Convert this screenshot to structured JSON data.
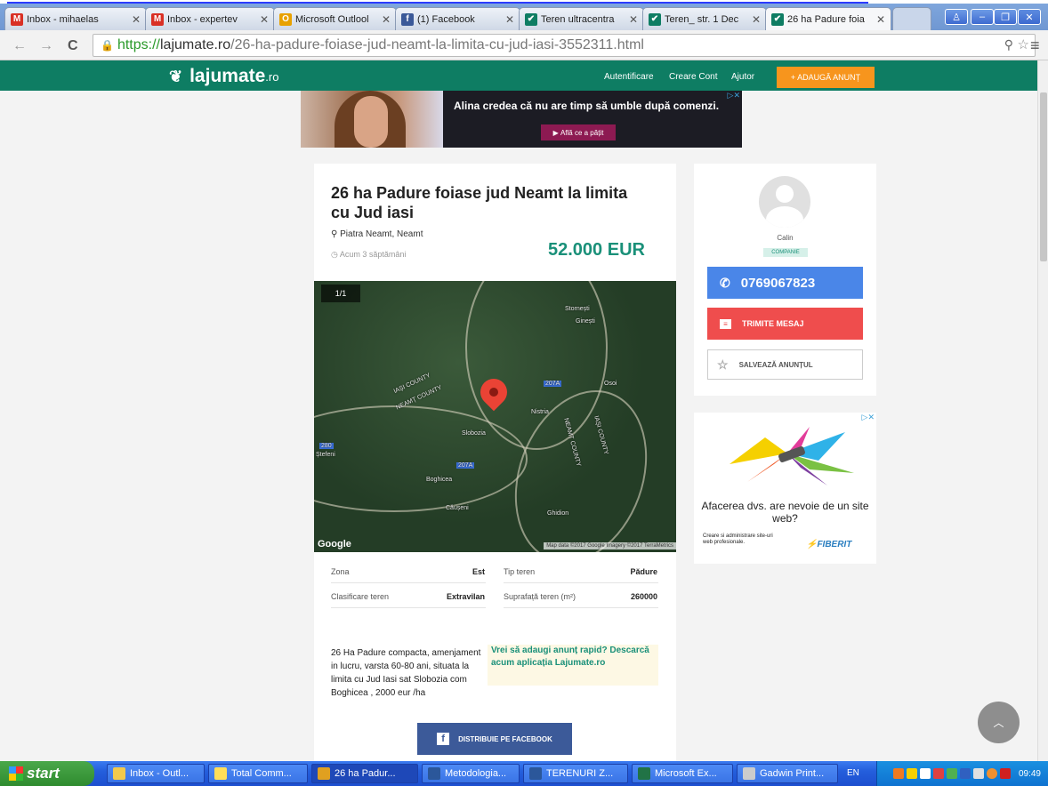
{
  "browser": {
    "tabs": [
      {
        "title": "Inbox - mihaelas",
        "icon": "gmail-icon",
        "color": "#d93025",
        "glyph": "M"
      },
      {
        "title": "Inbox - expertev",
        "icon": "gmail-icon",
        "color": "#d93025",
        "glyph": "M"
      },
      {
        "title": "Microsoft Outlool",
        "icon": "outlook-icon",
        "color": "#e8a100",
        "glyph": "O"
      },
      {
        "title": "(1) Facebook",
        "icon": "facebook-icon",
        "color": "#3b5998",
        "glyph": "f"
      },
      {
        "title": "Teren ultracentra",
        "icon": "lajumate-icon",
        "color": "#0e7d63",
        "glyph": "✔"
      },
      {
        "title": "Teren_ str. 1 Dec",
        "icon": "lajumate-icon",
        "color": "#0e7d63",
        "glyph": "✔"
      },
      {
        "title": "26 ha Padure foia",
        "icon": "lajumate-icon",
        "color": "#0e7d63",
        "glyph": "✔",
        "active": true
      }
    ],
    "url_prefix": "https://",
    "url_host": "lajumate.ro",
    "url_path": "/26-ha-padure-foiase-jud-neamt-la-limita-cu-jud-iasi-3552311.html"
  },
  "site": {
    "brand_color": "#0e7d63",
    "logo_text": "lajumate",
    "logo_suffix": ".ro",
    "nav": [
      "Autentificare",
      "Creare Cont",
      "Ajutor"
    ],
    "add_button": "+ ADAUGĂ ANUNȚ",
    "top_ad": {
      "text": "Alina credea că nu are timp să umble după comenzi.",
      "cta": "Află ce a pățit"
    }
  },
  "listing": {
    "title": "26 ha Padure foiase jud Neamt la limita cu Jud iasi",
    "location": "Piatra Neamt, Neamt",
    "posted": "Acum 3 săptămâni",
    "price": "52.000 EUR",
    "image_counter": "1/1",
    "map": {
      "labels": [
        "Stornești",
        "Ginești",
        "IAȘI COUNTY",
        "NEAMȚ COUNTY",
        "Nistria",
        "Slobozia",
        "Boghicea",
        "Căușeni",
        "Ghidion",
        "NEAMȚ COUNTY",
        "IAȘI COUNTY",
        "Osoi",
        "207A",
        "207A",
        "280",
        "Ștefeni"
      ],
      "google": "Google",
      "credit": "Map data ©2017 Google  Imagery ©2017 TerraMetrics"
    },
    "details": [
      {
        "label": "Zona",
        "value": "Est"
      },
      {
        "label": "Tip teren",
        "value": "Pădure"
      },
      {
        "label": "Clasificare teren",
        "value": "Extravilan"
      },
      {
        "label": "Suprafață teren (m²)",
        "value": "260000"
      }
    ],
    "description": "26 Ha Padure compacta, amenjament in lucru, varsta 60-80 ani, situata la limita cu Jud Iasi sat Slobozia com Boghicea , 2000 eur /ha",
    "promo": "Vrei să adaugi anunț rapid? Descarcă acum aplicația Lajumate.ro",
    "share_button": "DISTRIBUIE PE FACEBOOK"
  },
  "seller": {
    "name": "Calin",
    "badge": "COMPANIE",
    "phone": "0769067823",
    "message_button": "TRIMITE MESAJ",
    "save_button": "SALVEAZĂ ANUNȚUL"
  },
  "side_ad": {
    "title": "Afacerea dvs. are nevoie de un site web?",
    "subtitle": "Creare si administrare site-uri web profesionale.",
    "brand": "FIBERIT"
  },
  "taskbar": {
    "start": "start",
    "items": [
      {
        "title": "Inbox - Outl...",
        "icon": "outlook-icon",
        "color": "#f2c94c"
      },
      {
        "title": "Total Comm...",
        "icon": "totalcommander-icon",
        "color": "#ffde59"
      },
      {
        "title": "26 ha Padur...",
        "icon": "chrome-icon",
        "color": "#e0a020",
        "active": true
      },
      {
        "title": "Metodologia...",
        "icon": "word-icon",
        "color": "#2b579a"
      },
      {
        "title": "TERENURI Z...",
        "icon": "word-icon",
        "color": "#2b579a"
      },
      {
        "title": "Microsoft Ex...",
        "icon": "excel-icon",
        "color": "#217346"
      },
      {
        "title": "Gadwin Print...",
        "icon": "printer-icon",
        "color": "#cccccc"
      }
    ],
    "lang": "EN",
    "clock": "09:49"
  }
}
